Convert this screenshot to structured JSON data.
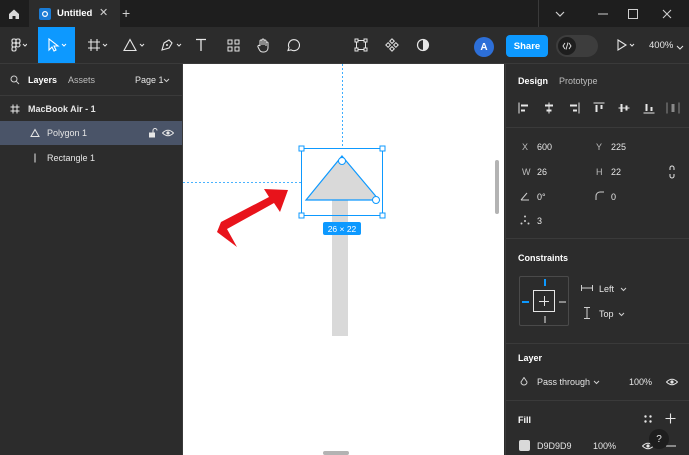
{
  "titlebar": {
    "tab_title": "Untitled",
    "close_glyph": "✕",
    "newtab_glyph": "+",
    "icons": [
      "home-icon",
      "figma-file-icon",
      "chevron-down-icon",
      "minimize-icon",
      "maximize-icon",
      "close-window-icon"
    ]
  },
  "toolbar": {
    "avatar_initial": "A",
    "share_label": "Share",
    "zoom": "400%",
    "icons": [
      "main-menu-icon",
      "move-tool-icon",
      "frame-tool-icon",
      "shape-tool-icon",
      "pen-tool-icon",
      "text-tool-icon",
      "resources-icon",
      "hand-tool-icon",
      "comment-icon",
      "crop-icon",
      "component-icon",
      "mask-icon",
      "dev-mode-icon",
      "play-icon"
    ]
  },
  "layers_panel": {
    "tabs": {
      "layers": "Layers",
      "assets": "Assets",
      "page": "Page 1"
    },
    "items": [
      {
        "label": "MacBook Air - 1",
        "type": "frame"
      },
      {
        "label": "Polygon 1",
        "type": "polygon",
        "selected": true
      },
      {
        "label": "Rectangle 1",
        "type": "rectangle"
      }
    ]
  },
  "canvas": {
    "size_badge": "26 × 22",
    "selection_color": "#0d99ff",
    "shape_fill": "#d9d9d9",
    "arrow_color": "#e8131b"
  },
  "design_panel": {
    "tabs": {
      "design": "Design",
      "prototype": "Prototype"
    },
    "position": {
      "x_label": "X",
      "x": "600",
      "y_label": "Y",
      "y": "225"
    },
    "size": {
      "w_label": "W",
      "w": "26",
      "h_label": "H",
      "h": "22"
    },
    "rotation": "0°",
    "corner_radius": "0",
    "point_count": "3",
    "constraints": {
      "title": "Constraints",
      "horizontal": "Left",
      "vertical": "Top"
    },
    "layer": {
      "title": "Layer",
      "blend": "Pass through",
      "opacity": "100%"
    },
    "fill": {
      "title": "Fill",
      "hex": "D9D9D9",
      "opacity": "100%",
      "color": "#d9d9d9"
    },
    "help": "?"
  }
}
